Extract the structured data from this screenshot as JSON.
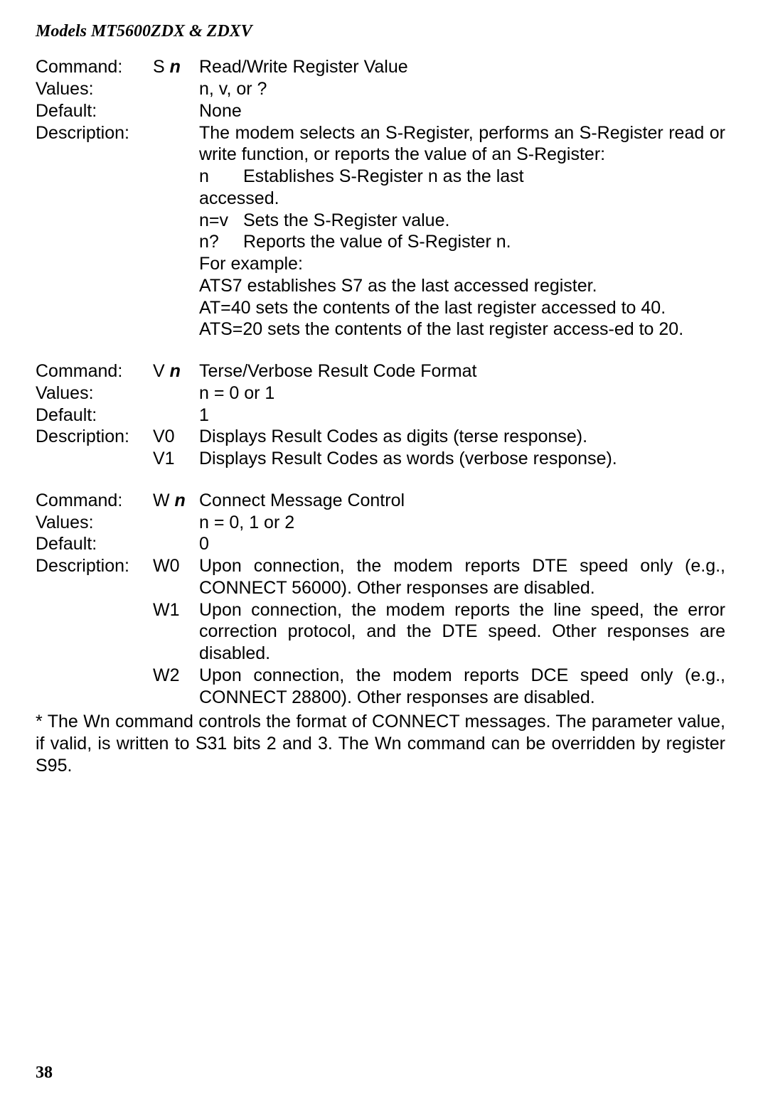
{
  "header": "Models  MT5600ZDX  &  ZDXV",
  "s": {
    "label_cmd": "Command:",
    "cmd_letter": "S ",
    "label_values": "Values:",
    "label_default": "Default:",
    "label_desc": "Description:",
    "title": "Read/Write  Register Value",
    "values": "n, v, or ?",
    "default": "None",
    "d1": "The modem selects an S-Register, performs an S-Register read or write function, or reports the value of an S-Register:",
    "opt_n_k": "n",
    "opt_n_v": "Establishes S-Register n as the last",
    "opt_n_cont": "accessed.",
    "opt_nv_k": "n=v",
    "opt_nv_v": "Sets the S-Register value.",
    "opt_nq_k": "n?",
    "opt_nq_v": "Reports the value of S-Register n.",
    "ex_label": "For example:",
    "ex1": "ATS7 establishes S7 as the last accessed register.",
    "ex2": "AT=40 sets the contents of the last register accessed to 40.",
    "ex3": "ATS=20 sets the contents of the last register access-ed to 20."
  },
  "v": {
    "label_cmd": "Command:",
    "cmd_letter": "V ",
    "label_values": "Values:",
    "label_default": "Default:",
    "label_desc": "Description:",
    "title": "Terse/Verbose Result Code Format",
    "values": "n = 0 or 1",
    "default": "1",
    "v0_k": "V0",
    "v0_v": "Displays Result Codes as digits (terse response).",
    "v1_k": "V1",
    "v1_v": "Displays Result Codes as words (verbose response)."
  },
  "w": {
    "label_cmd": "Command:",
    "cmd_letter": "W ",
    "label_values": "Values:",
    "label_default": "Default:",
    "label_desc": "Description:",
    "title": "Connect Message Control",
    "values": "n = 0, 1 or 2",
    "default": "0",
    "w0_k": "W0",
    "w0_v": "Upon connection, the modem reports DTE speed only (e.g., CONNECT 56000). Other responses are disabled.",
    "w1_k": "W1",
    "w1_v": "Upon connection, the modem reports the line speed, the error correction protocol, and the DTE speed.  Other responses are disabled.",
    "w2_k": "W2",
    "w2_v": "Upon connection, the modem reports DCE speed only (e.g., CONNECT 28800). Other responses are disabled."
  },
  "footnote": "*  The Wn command controls the format of CONNECT messages.  The parameter value, if valid, is written to S31 bits 2 and 3.  The Wn command can be overridden by register S95.",
  "page_num": "38"
}
